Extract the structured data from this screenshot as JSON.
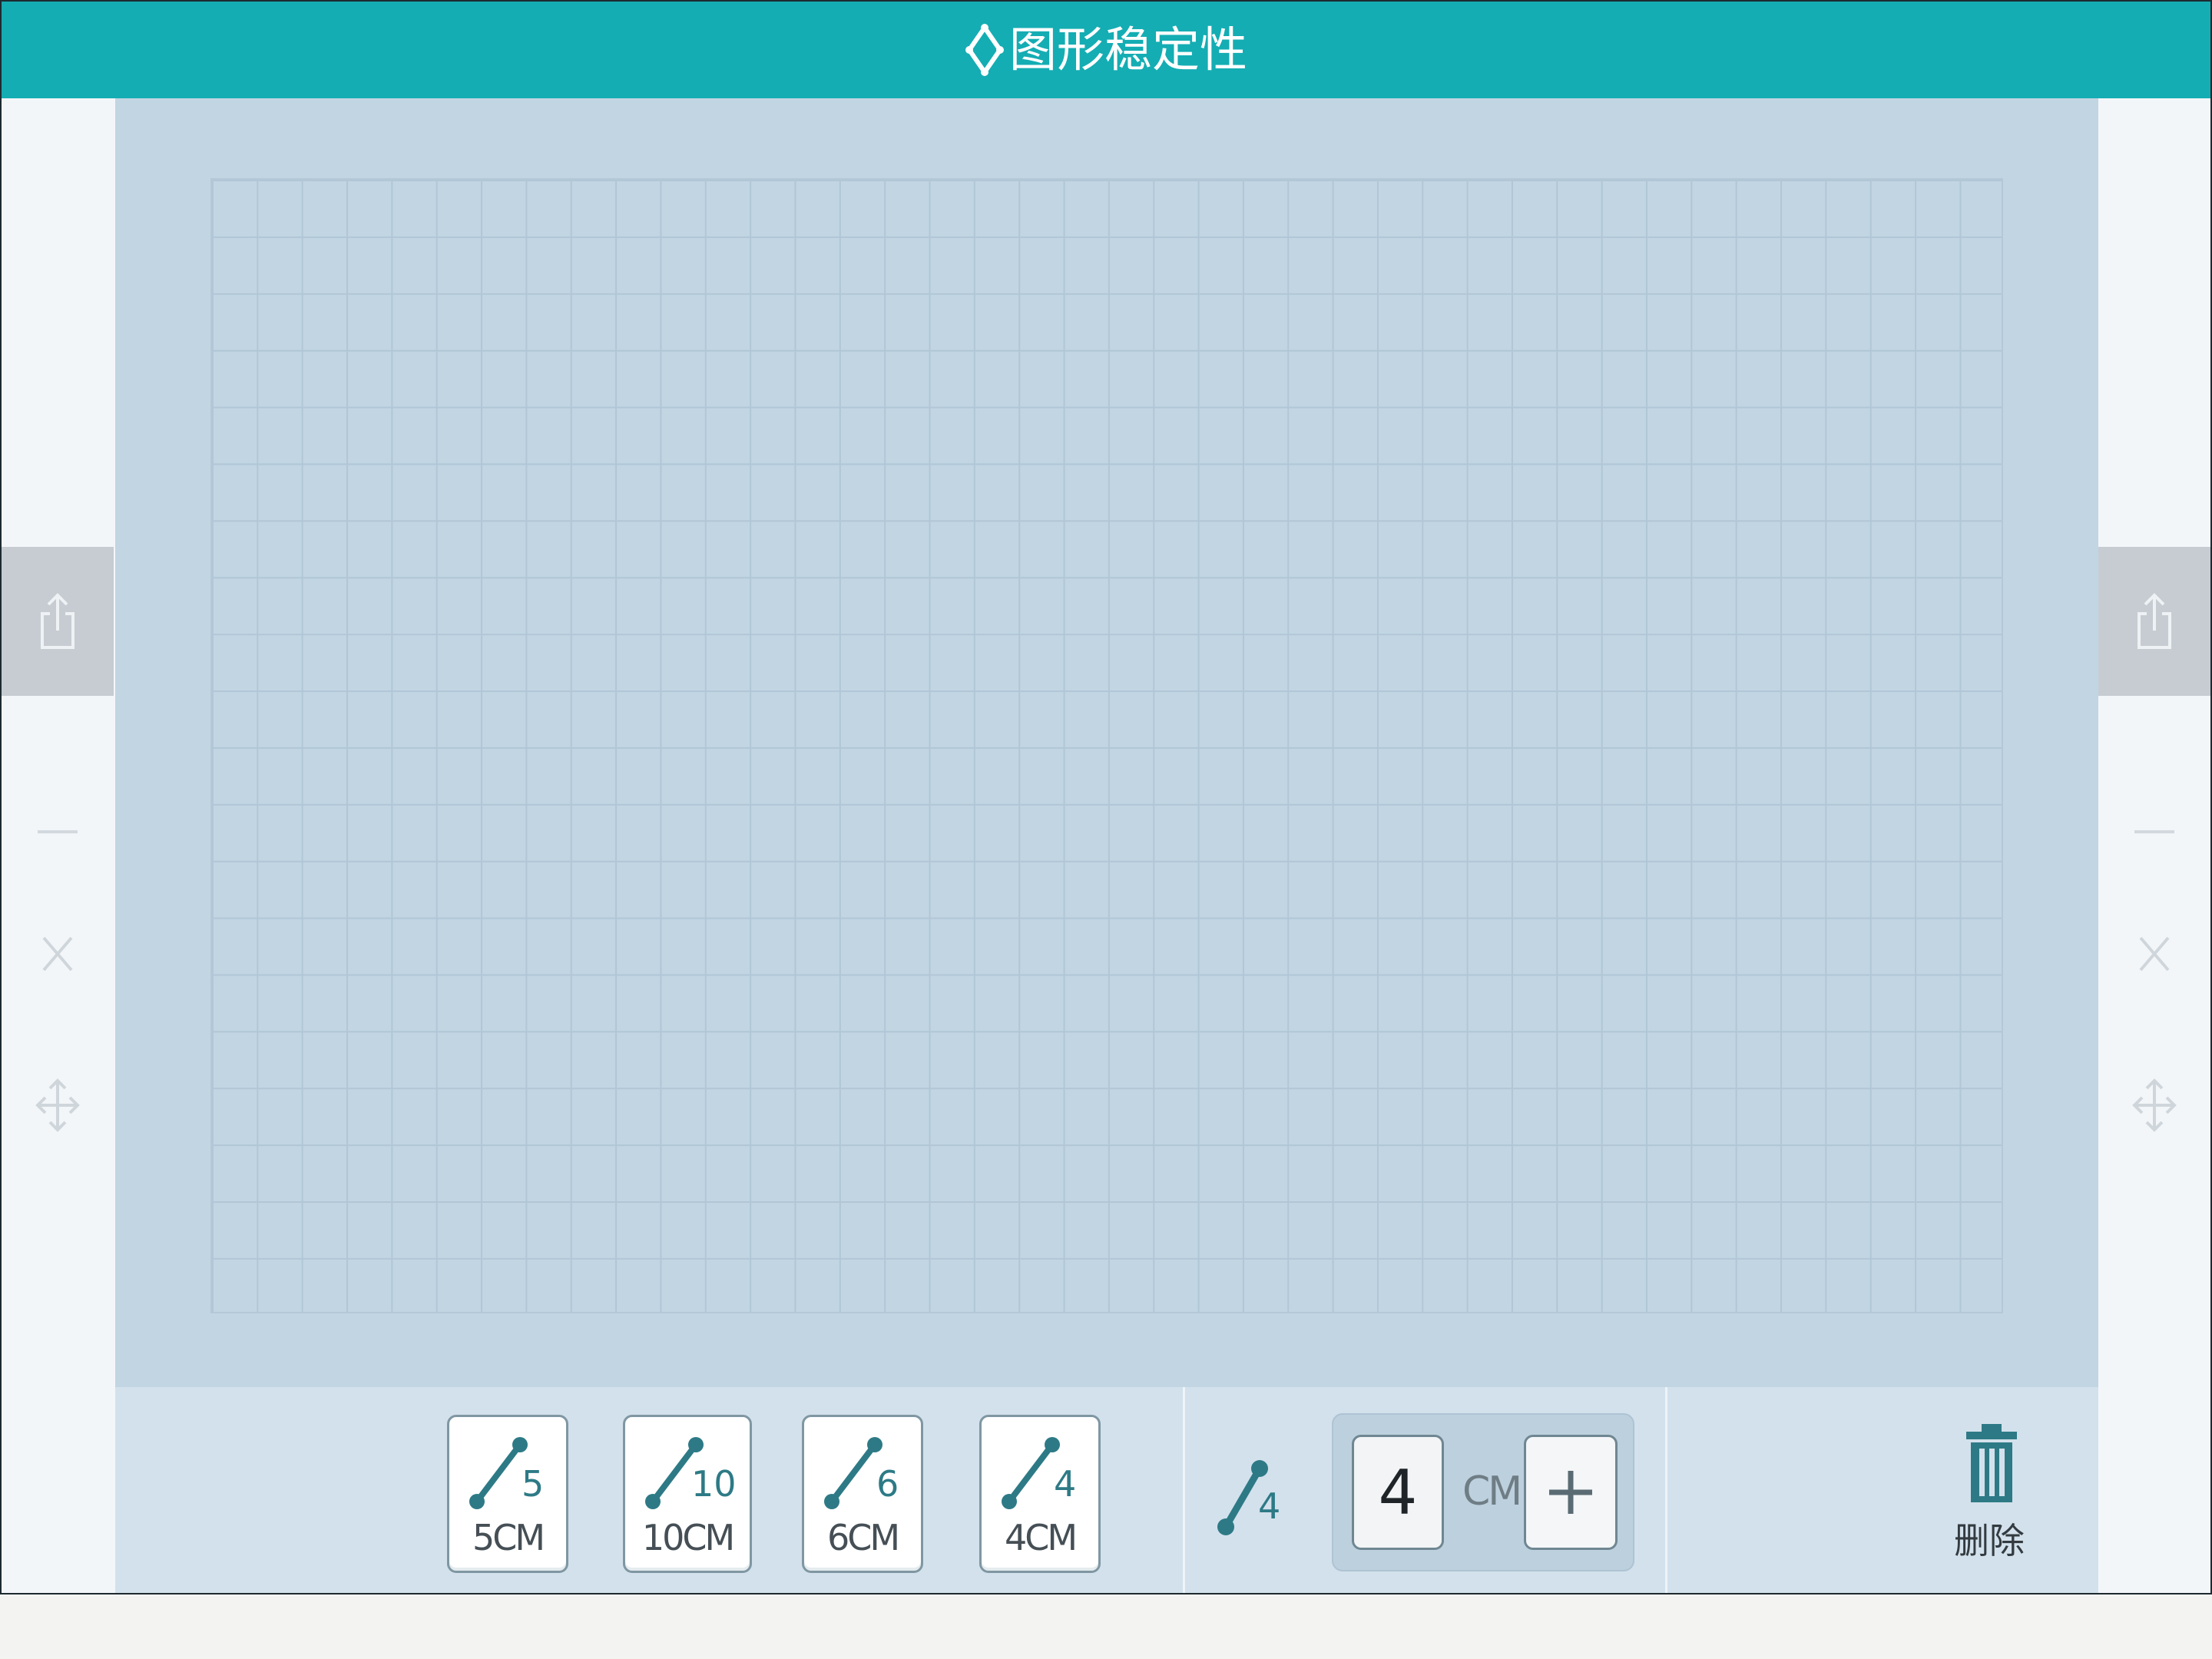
{
  "window": {
    "title": "图形稳定性"
  },
  "left_rail": {
    "share_icon": "share-icon",
    "minus_icon": "minus-icon",
    "close_icon": "close-x-icon",
    "move_icon": "move-arrows-icon"
  },
  "right_rail": {
    "share_icon": "share-icon",
    "minus_icon": "minus-icon",
    "close_icon": "close-x-icon",
    "move_icon": "move-arrows-icon"
  },
  "toolbar": {
    "sticks": [
      {
        "number": "5",
        "label": "5CM"
      },
      {
        "number": "10",
        "label": "10CM"
      },
      {
        "number": "6",
        "label": "6CM"
      },
      {
        "number": "4",
        "label": "4CM"
      }
    ],
    "custom_stick": {
      "number": "4"
    },
    "length": {
      "value": "4",
      "unit": "CM",
      "plus_icon": "plus-icon"
    },
    "delete": {
      "label": "删除",
      "icon": "trash-icon"
    }
  },
  "colors": {
    "titlebar": "#14adb3",
    "board": "#c2d5e3",
    "toolbar": "#d3e1ec",
    "stick_accent": "#2d7a86"
  }
}
